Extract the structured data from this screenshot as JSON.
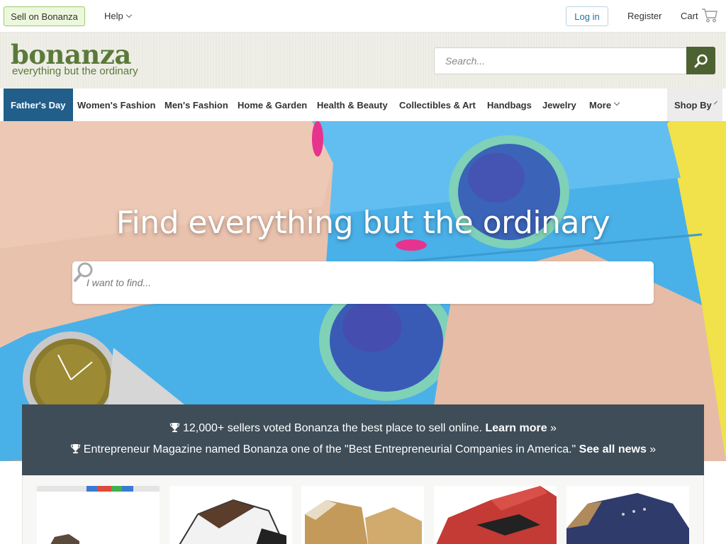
{
  "topbar": {
    "sell_label": "Sell on Bonanza",
    "help_label": "Help",
    "login_label": "Log in",
    "register_label": "Register",
    "cart_label": "Cart"
  },
  "header": {
    "logo_text": "bonanza",
    "logo_tagline": "everything but the ordinary",
    "search_placeholder": "Search..."
  },
  "nav": {
    "items": [
      {
        "label": "Father's Day",
        "active": true
      },
      {
        "label": "Women's Fashion"
      },
      {
        "label": "Men's Fashion"
      },
      {
        "label": "Home & Garden"
      },
      {
        "label": "Health & Beauty"
      },
      {
        "label": "Collectibles & Art"
      },
      {
        "label": "Handbags"
      },
      {
        "label": "Jewelry"
      },
      {
        "label": "More"
      }
    ],
    "shop_by_label": "Shop By"
  },
  "hero": {
    "title": "Find everything but the ordinary",
    "search_placeholder": "I want to find..."
  },
  "news": {
    "line1_text": "12,000+ sellers voted Bonanza the best place to sell online.",
    "line1_link": "Learn more",
    "line2_text": "Entrepreneur Magazine named Bonanza one of the \"Best Entrepreneurial Companies in America.\"",
    "line2_link": "See all news",
    "arrow": "»"
  },
  "colors": {
    "brand_green": "#5b7a3a",
    "nav_active": "#215e8a",
    "banner_bg": "#3e4d57",
    "search_button": "#4d6232"
  }
}
